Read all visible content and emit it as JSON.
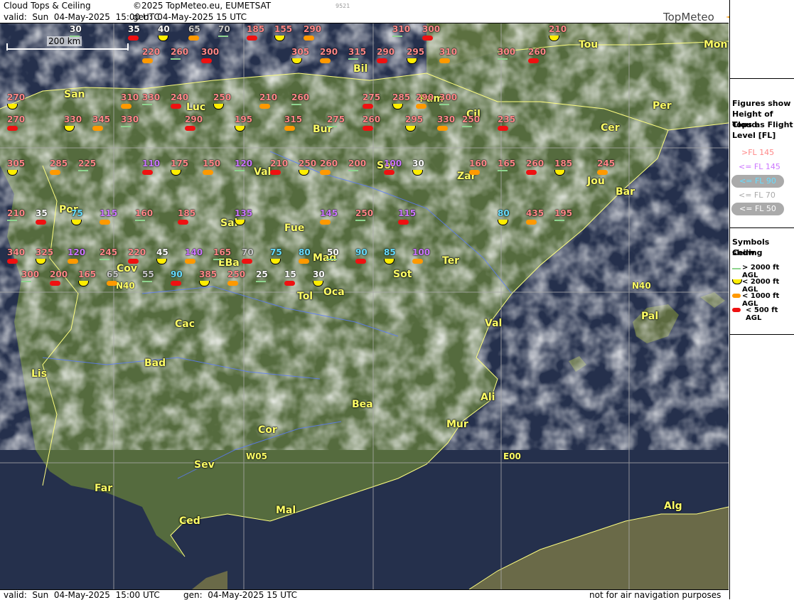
{
  "header": {
    "product": "Cloud Tops & Ceiling",
    "copyright": "©2025 TopMeteo.eu, EUMETSAT",
    "code": "9521",
    "valid": "valid:  Sun  04-May-2025  15:00 UTC",
    "gen": "gen:  04-May-2025 15 UTC",
    "logo": "TopMeteo"
  },
  "footer": {
    "valid": "valid:  Sun  04-May-2025  15:00 UTC",
    "gen": "gen:  04-May-2025 15 UTC",
    "disclaimer": "not for air navigation purposes"
  },
  "scale": "200 km",
  "colors": {
    "pink": "#ff8888",
    "violet": "#cc77ff",
    "cyan": "#66ddff",
    "grey": "#c8c8c8",
    "white": "#ffffff",
    "yellow": "#ffee00",
    "orange": "#ff9900",
    "red": "#ee1111",
    "green": "#8fd48f"
  },
  "legend": {
    "figures_title": [
      "Figures show",
      "Height of Cloud",
      "Tops as Flight",
      "Level  [FL]"
    ],
    "fl": [
      ">FL 145",
      "<= FL 145",
      "<= FL 90",
      "<= FL 70",
      "<= FL 50"
    ],
    "symbols_title": [
      "Symbols show",
      "Ceiling"
    ],
    "ceiling": [
      "> 2000 ft AGL",
      "< 2000 ft AGL",
      "< 1000 ft AGL",
      "< 500 ft AGL"
    ]
  },
  "grid_labels": [
    "N40",
    "N40",
    "W05",
    "E00"
  ],
  "cities": [
    "San",
    "Bil",
    "Pam",
    "Tou",
    "Mon",
    "Luc",
    "Cil",
    "Per",
    "Bur",
    "Cer",
    "Val",
    "Sor",
    "Zar",
    "Jou",
    "Bar",
    "Por",
    "Sal",
    "Fue",
    "Mad",
    "Ter",
    "Cov",
    "EBa",
    "Sot",
    "Tol",
    "Oca",
    "Cac",
    "Val",
    "Bad",
    "Lis",
    "Bea",
    "Ali",
    "Mur",
    "Cor",
    "Sev",
    "Far",
    "Mal",
    "Ced",
    "Alg",
    "Pal"
  ],
  "figures": [
    "30",
    "35",
    "40",
    "65",
    "70",
    "185",
    "155",
    "290",
    "310",
    "300",
    "210",
    "220",
    "260",
    "300",
    "305",
    "290",
    "315",
    "290",
    "295",
    "310",
    "300",
    "260",
    "270",
    "310",
    "330",
    "240",
    "250",
    "210",
    "260",
    "275",
    "285",
    "290",
    "300",
    "270",
    "330",
    "345",
    "330",
    "290",
    "195",
    "315",
    "275",
    "260",
    "295",
    "330",
    "250",
    "235",
    "305",
    "285",
    "225",
    "110",
    "175",
    "150",
    "120",
    "210",
    "250",
    "260",
    "200",
    "100",
    "30",
    "160",
    "165",
    "260",
    "185",
    "245",
    "210",
    "35",
    "75",
    "115",
    "160",
    "185",
    "135",
    "145",
    "250",
    "115",
    "80",
    "435",
    "195",
    "340",
    "325",
    "120",
    "245",
    "220",
    "45",
    "140",
    "165",
    "70",
    "75",
    "80",
    "50",
    "90",
    "85",
    "100",
    "300",
    "200",
    "165",
    "65",
    "55",
    "90",
    "385",
    "250",
    "25",
    "15",
    "30"
  ]
}
